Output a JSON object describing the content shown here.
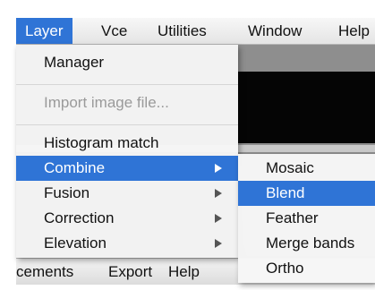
{
  "menubar": {
    "items": [
      {
        "label": "Layer"
      },
      {
        "label": "Vce"
      },
      {
        "label": "Utilities"
      },
      {
        "label": "Window"
      },
      {
        "label": "Help"
      }
    ]
  },
  "layer_menu": {
    "manager": "Manager",
    "import_image": "Import image file...",
    "histogram_match": "Histogram match",
    "combine": "Combine",
    "fusion": "Fusion",
    "correction": "Correction",
    "elevation": "Elevation"
  },
  "combine_submenu": {
    "mosaic": "Mosaic",
    "blend": "Blend",
    "feather": "Feather",
    "merge_bands": "Merge bands",
    "ortho": "Ortho"
  },
  "background_menubar": {
    "items": [
      {
        "label": "cements"
      },
      {
        "label": "Export"
      },
      {
        "label": "Help"
      }
    ]
  },
  "colors": {
    "highlight": "#2f74d6",
    "disabled_text": "#9a9a9a"
  }
}
